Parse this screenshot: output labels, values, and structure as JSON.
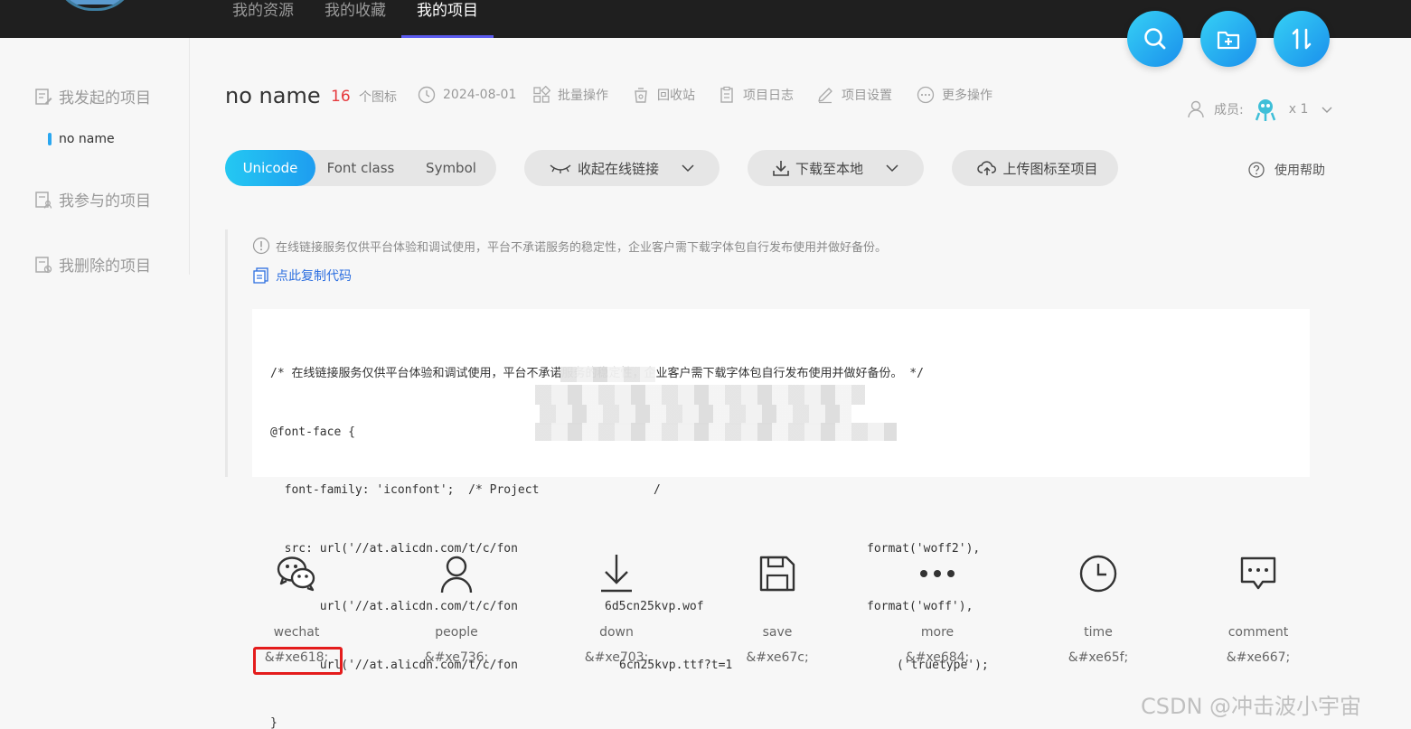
{
  "nav": {
    "items": [
      {
        "label": "我的资源",
        "active": false
      },
      {
        "label": "我的收藏",
        "active": false
      },
      {
        "label": "我的项目",
        "active": true
      }
    ]
  },
  "sidebar": {
    "items": [
      {
        "label": "我发起的项目"
      },
      {
        "label": "我参与的项目"
      },
      {
        "label": "我删除的项目"
      }
    ],
    "sub_item": "no name"
  },
  "project": {
    "name": "no name",
    "icon_count": "16",
    "icon_count_label": "个图标",
    "date": "2024-08-01",
    "actions": [
      "批量操作",
      "回收站",
      "项目日志",
      "项目设置",
      "更多操作"
    ],
    "members_label": "成员:",
    "members_count": "x 1"
  },
  "toolbar": {
    "tabs": [
      "Unicode",
      "Font class",
      "Symbol"
    ],
    "active_tab": "Unicode",
    "collapse_link": "收起在线链接",
    "download": "下载至本地",
    "upload": "上传图标至项目",
    "help": "使用帮助"
  },
  "notice": {
    "text": "在线链接服务仅供平台体验和调试使用，平台不承诺服务的稳定性，企业客户需下载字体包自行发布使用并做好备份。",
    "copy_link": "点此复制代码"
  },
  "code_lines": [
    "/* 在线链接服务仅供平台体验和调试使用，平台不承诺服务的稳定性，企业客户需下载字体包自行发布使用并做好备份。 */",
    "@font-face {",
    "  font-family: 'iconfont';  /* Project",
    "  src: url('//at.alicdn.com/t/c/fon",
    "       url('//at.alicdn.com/t/c/fon",
    "       url('//at.alicdn.com/t/c/fon",
    "}"
  ],
  "code_fragments": {
    "line3_tail": "/",
    "line4_tail": "format('woff2'),",
    "line5_mid": "6d5cn25kvp.wof",
    "line5_tail": "format('woff'),",
    "line6_mid": "6cn25kvp.ttf?t=1",
    "line6_tail": "('truetype');"
  },
  "icons": [
    {
      "name": "wechat",
      "code": "&#xe618;",
      "glyph": "wechat-icon"
    },
    {
      "name": "people",
      "code": "&#xe736;",
      "glyph": "people-icon"
    },
    {
      "name": "down",
      "code": "&#xe703;",
      "glyph": "down-icon"
    },
    {
      "name": "save",
      "code": "&#xe67c;",
      "glyph": "save-icon"
    },
    {
      "name": "more",
      "code": "&#xe684;",
      "glyph": "more-icon"
    },
    {
      "name": "time",
      "code": "&#xe65f;",
      "glyph": "time-icon"
    },
    {
      "name": "comment",
      "code": "&#xe667;",
      "glyph": "comment-icon"
    }
  ],
  "watermark": "CSDN @冲击波小宇宙",
  "colors": {
    "accent": "#1e9df0",
    "count_red": "#e6393d",
    "highlight_red": "#e41c1c",
    "link_blue": "#2d6fe0"
  }
}
